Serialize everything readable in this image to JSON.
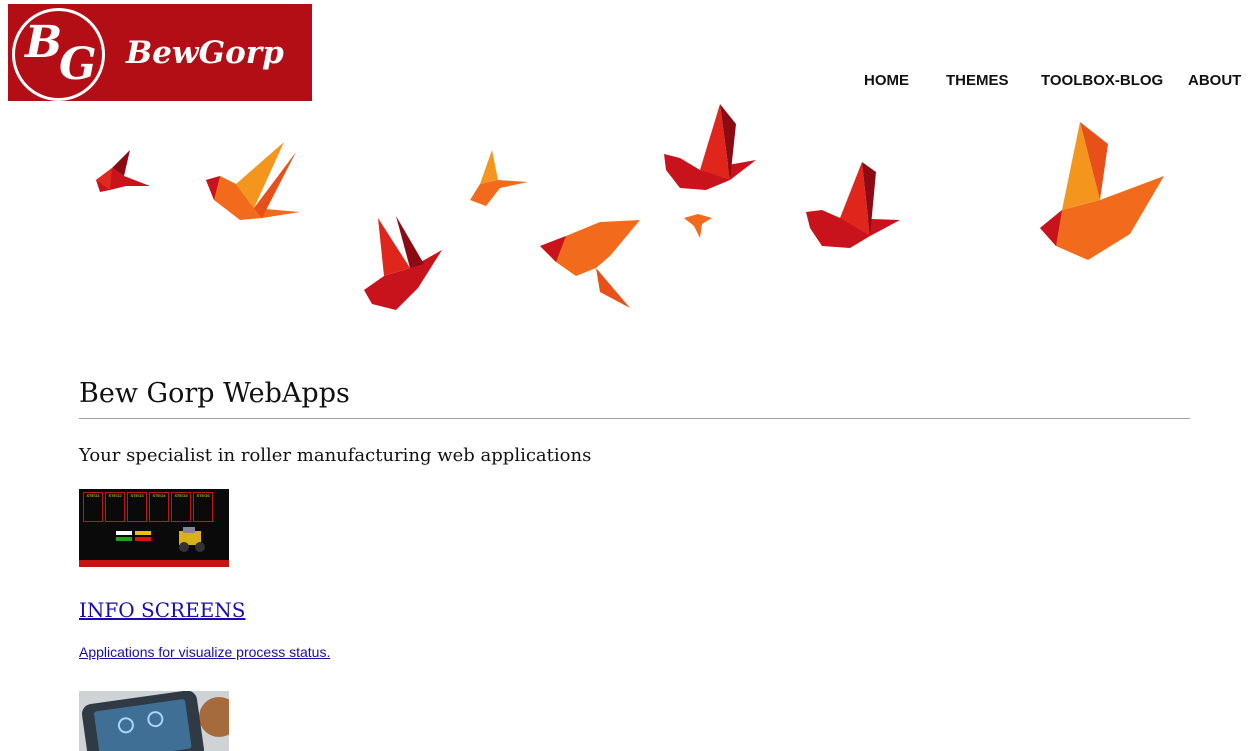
{
  "brand": {
    "monogram": "BG",
    "monogram_b": "B",
    "monogram_g": "G",
    "name": "BewGorp",
    "color": "#b30e16"
  },
  "nav": {
    "items": [
      {
        "label": "HOME"
      },
      {
        "label": "THEMES"
      },
      {
        "label": "TOOLBOX-BLOG"
      },
      {
        "label": "ABOUT"
      }
    ]
  },
  "hero": {
    "image": "origami-birds",
    "colors": [
      "#c8121c",
      "#f26a1b",
      "#f4961e",
      "#8c0a14"
    ]
  },
  "main": {
    "title": "Bew Gorp WebApps",
    "tagline": "Your specialist in roller manufacturing web applications",
    "sections": [
      {
        "title": "INFO SCREENS",
        "description": "Applications for visualize process status.",
        "thumbnail": "info-screen-dashboard",
        "steg_labels": [
          "STEG1",
          "STEG2",
          "STEG3",
          "STEG4",
          "STEG5",
          "STEG6"
        ]
      },
      {
        "thumbnail": "tablet-app-photo"
      }
    ]
  },
  "colors": {
    "link": "#1a0dab",
    "text": "#111111",
    "rule": "#a0a0a0"
  }
}
